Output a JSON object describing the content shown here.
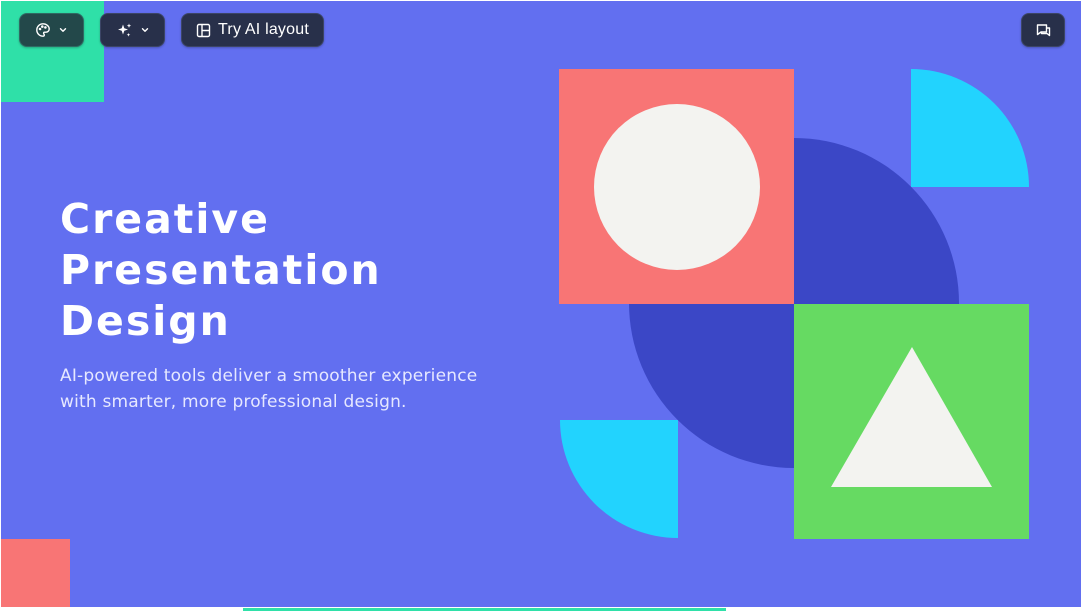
{
  "toolbar": {
    "theme": {
      "icon": "palette-icon",
      "dropdown_icon": "chevron-down-icon"
    },
    "ai": {
      "icon": "sparkle-icon",
      "dropdown_icon": "chevron-down-icon"
    },
    "layout": {
      "icon": "layout-icon",
      "label": "Try AI layout"
    },
    "comment": {
      "icon": "comment-icon"
    }
  },
  "slide": {
    "title_lines": [
      "Creative",
      "Presentation",
      "Design"
    ],
    "subtitle": "AI-powered tools deliver a smoother experience with smarter, more professional design."
  },
  "colors": {
    "background": "#626ff0",
    "coral": "#f87575",
    "mint": "#2fe0a8",
    "cyan": "#22d3fe",
    "indigo": "#3b47c6",
    "green": "#66da62",
    "offwhite": "#f3f3f0",
    "toolbar": "#28304a"
  }
}
